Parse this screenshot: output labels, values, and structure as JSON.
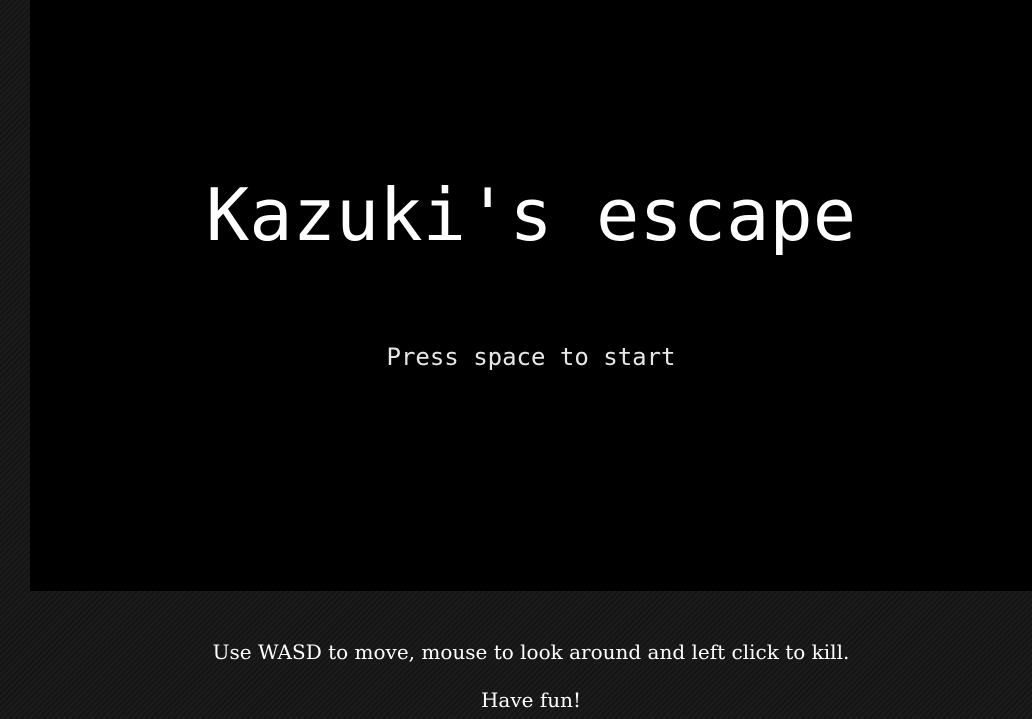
{
  "game": {
    "title": "Kazuki's escape",
    "start_prompt": "Press space to start"
  },
  "instructions": {
    "controls": "Use WASD to move, mouse to look around and left click to kill.",
    "closing": "Have fun!"
  },
  "colors": {
    "page_background": "#181818",
    "canvas_background": "#000000",
    "text": "#ffffff"
  }
}
